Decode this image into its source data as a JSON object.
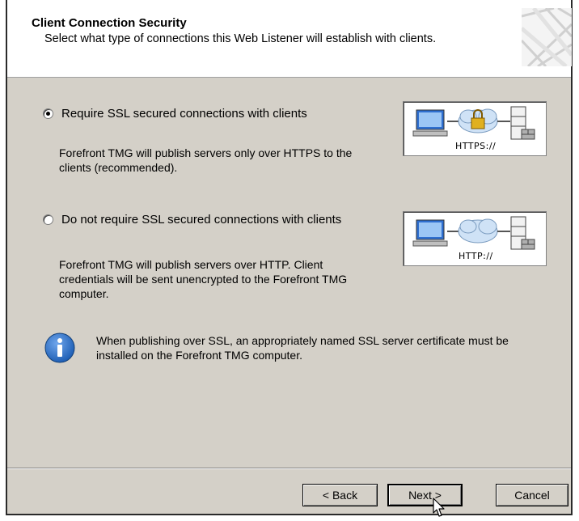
{
  "header": {
    "title": "Client Connection Security",
    "subtitle": "Select what type of connections this Web Listener will establish with clients."
  },
  "options": [
    {
      "label": "Require SSL secured connections with clients",
      "selected": true,
      "description": [
        "Forefront TMG will publish servers only over HTTPS to the",
        "clients (recommended)."
      ],
      "diagram_label": "HTTPS://",
      "diagram_icons": [
        "computer-icon",
        "cloud-icon",
        "lock-icon",
        "server-icon",
        "firewall-icon"
      ]
    },
    {
      "label": "Do not require SSL secured connections with clients",
      "selected": false,
      "description": [
        "Forefront TMG will publish servers over HTTP. Client",
        "credentials will be sent unencrypted to the Forefront TMG",
        "computer."
      ],
      "diagram_label": "HTTP://",
      "diagram_icons": [
        "computer-icon",
        "cloud-icon",
        "server-icon",
        "firewall-icon"
      ]
    }
  ],
  "info": {
    "icon": "info-icon",
    "lines": [
      "When publishing over SSL, an appropriately named SSL server certificate must be",
      "installed on the Forefront TMG computer."
    ]
  },
  "buttons": {
    "back": "< Back",
    "next": "Next >",
    "cancel": "Cancel"
  },
  "colors": {
    "dialog_bg": "#d4d0c8",
    "header_bg": "#ffffff",
    "info_blue": "#1f5fb5"
  }
}
